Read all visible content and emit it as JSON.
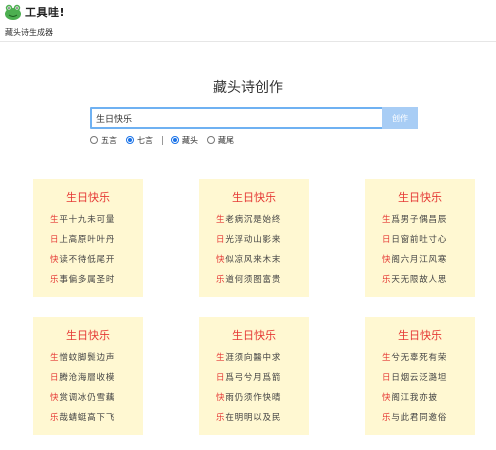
{
  "brand": {
    "name": "工具哇!"
  },
  "subnav": {
    "label": "藏头诗生成器"
  },
  "main": {
    "title": "藏头诗创作",
    "search": {
      "value": "生日快乐",
      "button_label": "创作"
    },
    "options": {
      "length": [
        {
          "label": "五言",
          "selected": false
        },
        {
          "label": "七言",
          "selected": true
        }
      ],
      "position": [
        {
          "label": "藏头",
          "selected": true
        },
        {
          "label": "藏尾",
          "selected": false
        }
      ]
    }
  },
  "colors": {
    "accent": "#e53935",
    "card_bg": "#fff8d2",
    "input_border": "#6fb1f2",
    "button_bg": "#a8cdf5"
  },
  "poems": [
    {
      "title": "生日快乐",
      "lines": [
        {
          "head": "生",
          "rest": "平十九未可量"
        },
        {
          "head": "日",
          "rest": "上高原叶叶丹"
        },
        {
          "head": "快",
          "rest": "读不待低尾开"
        },
        {
          "head": "乐",
          "rest": "事偏多属圣时"
        }
      ]
    },
    {
      "title": "生日快乐",
      "lines": [
        {
          "head": "生",
          "rest": "老病沉是始终"
        },
        {
          "head": "日",
          "rest": "光浮动山影来"
        },
        {
          "head": "快",
          "rest": "似凉风来木末"
        },
        {
          "head": "乐",
          "rest": "道何须图富贵"
        }
      ]
    },
    {
      "title": "生日快乐",
      "lines": [
        {
          "head": "生",
          "rest": "爲男子偶昌辰"
        },
        {
          "head": "日",
          "rest": "日窗前吐寸心"
        },
        {
          "head": "快",
          "rest": "阁六月江风寒"
        },
        {
          "head": "乐",
          "rest": "天无限故人思"
        }
      ]
    },
    {
      "title": "生日快乐",
      "lines": [
        {
          "head": "生",
          "rest": "憎蚊脚鬓边声"
        },
        {
          "head": "日",
          "rest": "腾沧海層收模"
        },
        {
          "head": "快",
          "rest": "赏调冰仍雪藕"
        },
        {
          "head": "乐",
          "rest": "哉蜻蜓高下飞"
        }
      ]
    },
    {
      "title": "生日快乐",
      "lines": [
        {
          "head": "生",
          "rest": "涯须向醫中求"
        },
        {
          "head": "日",
          "rest": "爲弓兮月爲箭"
        },
        {
          "head": "快",
          "rest": "雨仍须作快晴"
        },
        {
          "head": "乐",
          "rest": "在明明以及民"
        }
      ]
    },
    {
      "title": "生日快乐",
      "lines": [
        {
          "head": "生",
          "rest": "兮无辜死有荣"
        },
        {
          "head": "日",
          "rest": "日烟云泛潞坦"
        },
        {
          "head": "快",
          "rest": "阁江我亦披"
        },
        {
          "head": "乐",
          "rest": "与此君同邀俗"
        }
      ]
    }
  ]
}
